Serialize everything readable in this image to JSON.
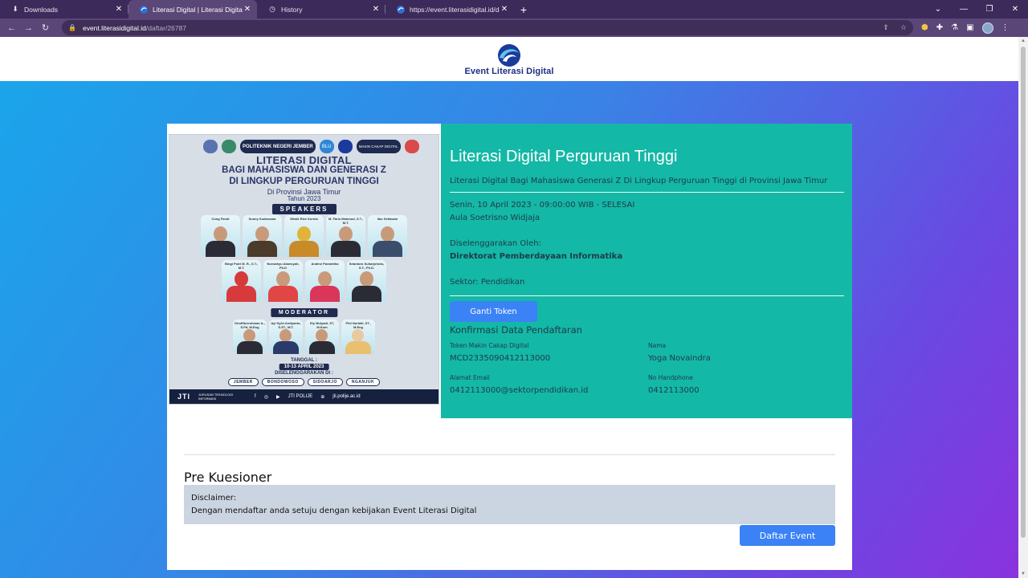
{
  "browser": {
    "tabs": [
      {
        "title": "Downloads",
        "icon": "download-icon",
        "active": false
      },
      {
        "title": "Literasi Digital | Literasi Digital Pe",
        "icon": "kominfo-icon",
        "active": true
      },
      {
        "title": "History",
        "icon": "history-icon",
        "active": false
      },
      {
        "title": "https://event.literasidigital.id/dap",
        "icon": "kominfo-icon",
        "active": false
      }
    ],
    "url_host": "event.literasidigital.id",
    "url_path": "/daftar/26787"
  },
  "site": {
    "logo_text": "Event Literasi Digital"
  },
  "poster": {
    "logos": [
      "",
      "",
      "POLITEKNIK NEGERI JEMBER",
      "BLU",
      "",
      "MAKIN CAKAP DIGITAL",
      ""
    ],
    "title_1": "LITERASI DIGITAL",
    "title_2": "BAGI MAHASISWA DAN GENERASI Z",
    "title_3": "DI LINGKUP PERGURUAN TINGGI",
    "title_4": "Di Provinsi Jawa Timur",
    "title_5": "Tahun 2023",
    "speakers_label": "SPEAKERS",
    "speakers_row1": [
      "Cong Fandi",
      "Sunny Sudarsana",
      "Wiwik Rize Kurnia",
      "M. Faris Mahmud, S.T., M.T.",
      "Ilan Setiawan"
    ],
    "speakers_row2": [
      "Bingi Putri M. R., S.T., M.T.",
      "Nurwahyu Alamsyah, Ph.D",
      "Andine Paramitha",
      "Sriantoro Suharjohoto, S.T., Ph.D."
    ],
    "moderator_label": "MODERATOR",
    "moderators": [
      "Khoffiturrohman A., S.Pd, M.Eng",
      "Ayi Sylvi Ardiyanto, S.ST., M.T.",
      "Ely Mulyadi, ST, M.Kom",
      "Phil Nurlaili, ST., M.Eng"
    ],
    "date_label": "TANGGAL :",
    "date_value": "10-13 APRIL 2023",
    "organizer_label": "DISELENGGARAKAN DI :",
    "cities": [
      "JEMBER",
      "BONDOWOSO",
      "SIDOARJO",
      "NGANJUK"
    ],
    "footer_brand": "JTI",
    "footer_dept": "JURUSAN TEKNOLOGI INFORMASI",
    "footer_social": "JTI POLIJE",
    "footer_site": "jti.polije.ac.id"
  },
  "event": {
    "title": "Literasi Digital Perguruan Tinggi",
    "subtitle": "Literasi Digital Bagi Mahasiswa Generasi Z Di Lingkup Perguruan Tinggi di Provinsi Jawa Timur",
    "datetime": "Senin, 10 April 2023 - 09:00:00 WIB - SELESAI",
    "venue": "Aula Soetrisno Widjaja",
    "organized_label": "Diselenggarakan Oleh:",
    "organizer": "Direktorat Pemberdayaan Informatika",
    "sector": "Sektor: Pendidikan",
    "change_token_label": "Ganti Token"
  },
  "confirmation": {
    "title": "Konfirmasi Data Pendaftaran",
    "token_label": "Token Makin Cakap Digital",
    "token_value": "MCD2335090412113000",
    "name_label": "Nama",
    "name_value": "Yoga Novaindra",
    "email_label": "Alamat Email",
    "email_value": "0412113000@sektorpendidikan.id",
    "phone_label": "No Handphone",
    "phone_value": "0412113000"
  },
  "questionnaire": {
    "title": "Pre Kuesioner",
    "disclaimer_label": "Disclaimer:",
    "disclaimer_text": "Dengan mendaftar anda setuju dengan kebijakan Event Literasi Digital",
    "register_label": "Daftar Event"
  },
  "colors": {
    "info_panel": "#14b8a6",
    "button": "#3b82f6",
    "gradient_start": "#1aa5ea",
    "gradient_end": "#8a33de"
  }
}
